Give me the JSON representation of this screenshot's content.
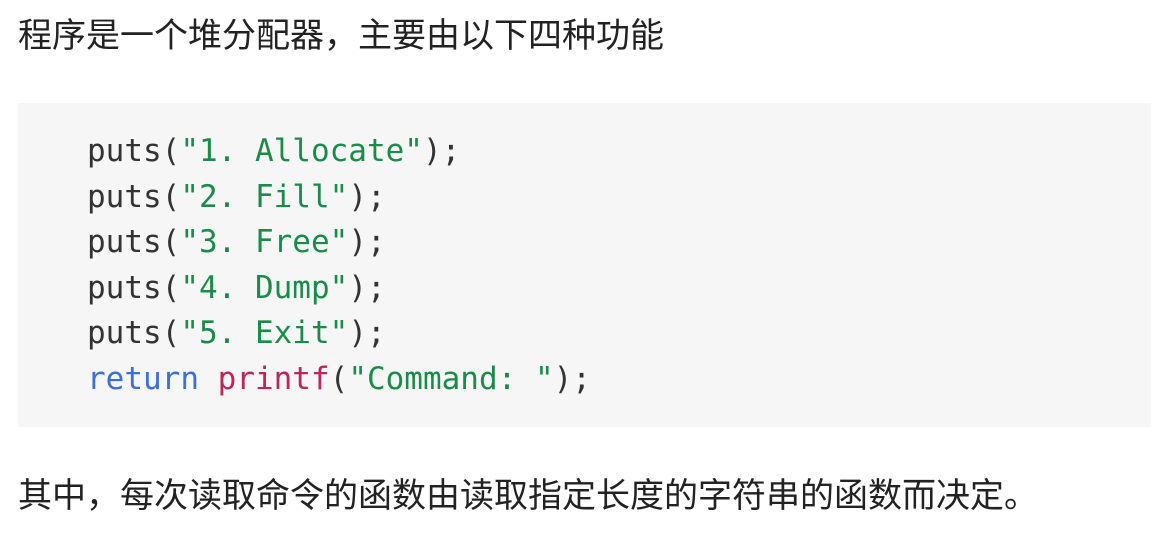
{
  "intro_text": "程序是一个堆分配器，主要由以下四种功能",
  "code": {
    "lines": [
      {
        "fn": "puts",
        "open": "(",
        "arg": "\"1. Allocate\"",
        "close": ");"
      },
      {
        "fn": "puts",
        "open": "(",
        "arg": "\"2. Fill\"",
        "close": ");"
      },
      {
        "fn": "puts",
        "open": "(",
        "arg": "\"3. Free\"",
        "close": ");"
      },
      {
        "fn": "puts",
        "open": "(",
        "arg": "\"4. Dump\"",
        "close": ");"
      },
      {
        "fn": "puts",
        "open": "(",
        "arg": "\"5. Exit\"",
        "close": ");"
      }
    ],
    "return_line": {
      "keyword": "return",
      "space": " ",
      "fn": "printf",
      "open": "(",
      "arg": "\"Command: \"",
      "close": ");"
    }
  },
  "outro_text": "其中，每次读取命令的函数由读取指定长度的字符串的函数而决定。",
  "colors": {
    "code_background": "#f6f6f6",
    "string": "#1a8c4a",
    "keyword": "#3b6fd9",
    "function_call": "#c0245c",
    "plain_code": "#333333"
  }
}
